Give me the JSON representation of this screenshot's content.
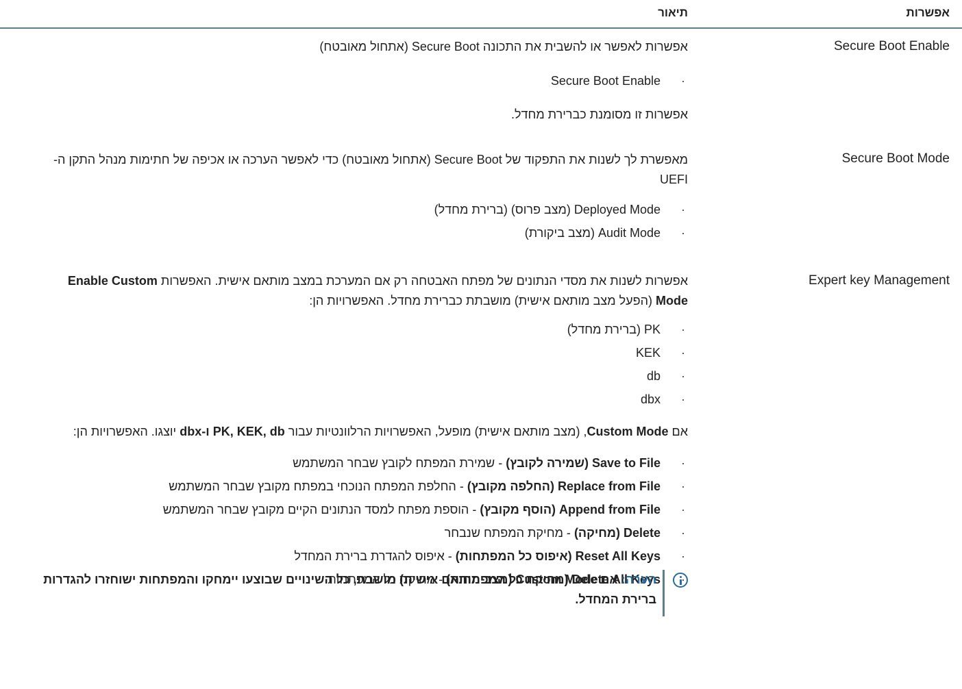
{
  "header": {
    "option": "אפשרות",
    "description": "תיאור"
  },
  "rows": [
    {
      "option": "Secure Boot Enable",
      "intro": "אפשרות לאפשר או להשבית את התכונה Secure Boot (אתחול מאובטח)",
      "bullets": [
        "Secure Boot Enable"
      ],
      "after": "אפשרות זו מסומנת כברירת מחדל."
    },
    {
      "option": "Secure Boot Mode",
      "intro": "מאפשרת לך לשנות את התפקוד של Secure Boot (אתחול מאובטח) כדי לאפשר הערכה או אכיפה של חתימות מנהל התקן ה-UEFI",
      "bullets": [
        "Deployed Mode (מצב פרוס) (ברירת מחדל)",
        "Audit Mode (מצב ביקורת)"
      ]
    },
    {
      "option": "Expert key Management",
      "intro_a": "אפשרות לשנות את מסדי הנתונים של מפתח האבטחה רק אם המערכת במצב מותאם אישית. האפשרות",
      "intro_bold": "Enable Custom Mode",
      "intro_b": "(הפעל מצב מותאם אישית) מושבתת כברירת מחדל. האפשרויות הן:",
      "bullets": [
        "PK (ברירת מחדל)",
        "KEK",
        "db",
        "dbx"
      ],
      "custom_pre": "אם",
      "custom_bold1": "Custom Mode",
      "custom_mid": ", (מצב מותאם אישית) מופעל, האפשרויות הרלוונטיות עבור",
      "custom_bold2": "PK, KEK, db ו-dbx",
      "custom_post": "יוצגו. האפשרויות הן:",
      "actions": [
        {
          "name": "Save to File (שמירה לקובץ)",
          "text": " - שמירת המפתח לקובץ שבחר המשתמש"
        },
        {
          "name": "Replace from File (החלפה מקובץ)",
          "text": " - החלפת המפתח הנוכחי במפתח מקובץ שבחר המשתמש"
        },
        {
          "name": "Append from File (הוסף מקובץ)",
          "text": " - הוספת מפתח למסד הנתונים הקיים מקובץ שבחר המשתמש"
        },
        {
          "name": "Delete (מחיקה)",
          "text": " - מחיקת המפתח שנבחר"
        },
        {
          "name": "Reset All Keys (איפוס כל המפתחות)",
          "text": " - איפוס להגדרת ברירת המחדל"
        },
        {
          "name": "Delete All Keys (מחיקת כל המפתחות)",
          "text": " - מחיקת כל המפתחות"
        }
      ]
    }
  ],
  "note": {
    "label": "הערה:",
    "text": "אם Custom Mode (מצב מותאם אישית) מושבת, כל השינויים שבוצעו יימחקו והמפתחות ישוחזרו להגדרות ברירת המחדל."
  }
}
